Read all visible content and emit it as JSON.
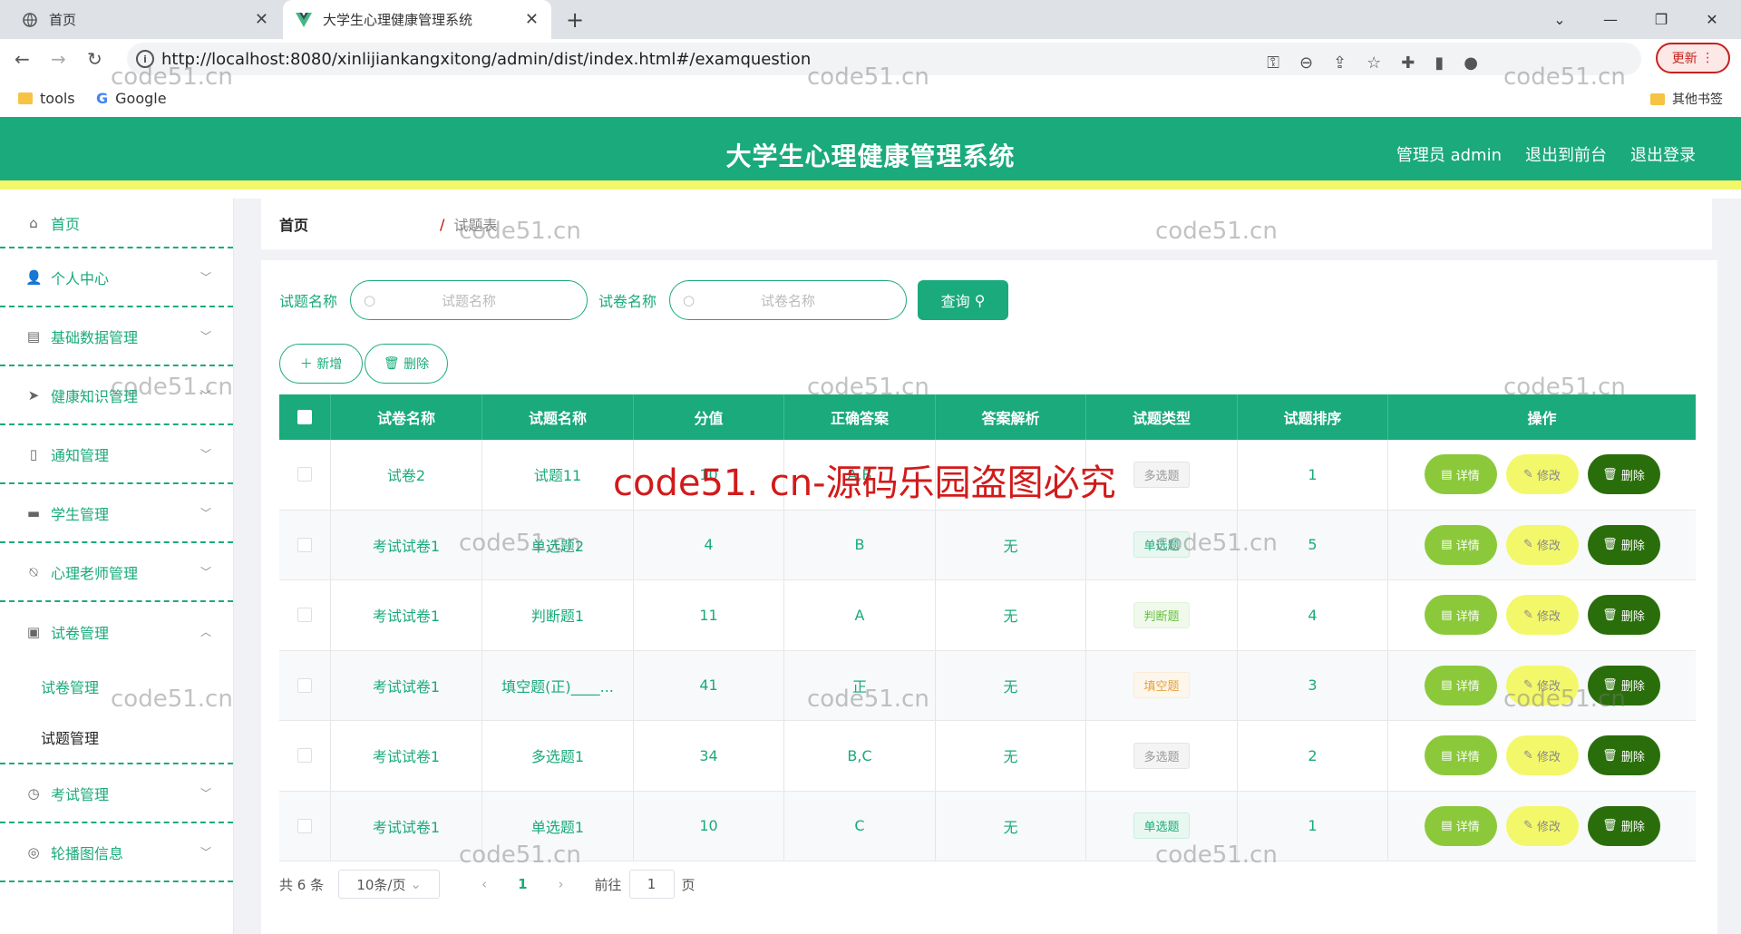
{
  "browser": {
    "tabs": [
      {
        "label": "首页"
      },
      {
        "label": "大学生心理健康管理系统"
      }
    ],
    "url": "http://localhost:8080/xinlijiankangxitong/admin/dist/index.html#/examquestion",
    "update_label": "更新",
    "bookmarks": [
      {
        "label": "tools"
      },
      {
        "label": "Google"
      }
    ],
    "other_bookmarks": "其他书签"
  },
  "header": {
    "title": "大学生心理健康管理系统",
    "admin_label": "管理员 admin",
    "front_label": "退出到前台",
    "logout_label": "退出登录"
  },
  "sidebar": {
    "items": [
      {
        "label": "首页",
        "icon": "home-icon"
      },
      {
        "label": "个人中心",
        "icon": "user-icon"
      },
      {
        "label": "基础数据管理",
        "icon": "clipboard-icon"
      },
      {
        "label": "健康知识管理",
        "icon": "send-icon"
      },
      {
        "label": "通知管理",
        "icon": "phone-icon"
      },
      {
        "label": "学生管理",
        "icon": "brush-icon"
      },
      {
        "label": "心理老师管理",
        "icon": "bell-off-icon"
      },
      {
        "label": "试卷管理",
        "icon": "checklist-icon"
      },
      {
        "label": "考试管理",
        "icon": "clock-icon"
      },
      {
        "label": "轮播图信息",
        "icon": "compass-icon"
      }
    ],
    "sub_items": [
      {
        "label": "试卷管理"
      },
      {
        "label": "试题管理"
      }
    ]
  },
  "breadcrumb": {
    "home": "首页",
    "separator": "/",
    "current": "试题表"
  },
  "search": {
    "question_label": "试题名称",
    "question_placeholder": "试题名称",
    "paper_label": "试卷名称",
    "paper_placeholder": "试卷名称",
    "query_label": "查询"
  },
  "actions": {
    "add_label": "新增",
    "delete_label": "删除"
  },
  "table": {
    "headers": [
      "试卷名称",
      "试题名称",
      "分值",
      "正确答案",
      "答案解析",
      "试题类型",
      "试题排序",
      "操作"
    ],
    "rows": [
      {
        "paper": "试卷2",
        "question": "试题11",
        "score": "10",
        "answer": "A,B",
        "analysis": "",
        "type": "多选题",
        "type_class": "multi",
        "order": "1"
      },
      {
        "paper": "考试试卷1",
        "question": "单选题2",
        "score": "4",
        "answer": "B",
        "analysis": "无",
        "type": "单选题",
        "type_class": "single",
        "order": "5"
      },
      {
        "paper": "考试试卷1",
        "question": "判断题1",
        "score": "11",
        "answer": "A",
        "analysis": "无",
        "type": "判断题",
        "type_class": "judge",
        "order": "4"
      },
      {
        "paper": "考试试卷1",
        "question": "填空题(正)____...",
        "score": "41",
        "answer": "正",
        "analysis": "无",
        "type": "填空题",
        "type_class": "fill",
        "order": "3"
      },
      {
        "paper": "考试试卷1",
        "question": "多选题1",
        "score": "34",
        "answer": "B,C",
        "analysis": "无",
        "type": "多选题",
        "type_class": "multi",
        "order": "2"
      },
      {
        "paper": "考试试卷1",
        "question": "单选题1",
        "score": "10",
        "answer": "C",
        "analysis": "无",
        "type": "单选题",
        "type_class": "single",
        "order": "1"
      }
    ],
    "op_detail": "详情",
    "op_edit": "修改",
    "op_delete": "删除"
  },
  "pager": {
    "total": "共 6 条",
    "page_size": "10条/页",
    "current_page": "1",
    "goto_label": "前往",
    "goto_value": "1",
    "page_suffix": "页"
  },
  "watermark": {
    "text": "code51.cn",
    "red_text": "code51. cn-源码乐园盗图必究"
  },
  "colors": {
    "primary": "#1aaa7b",
    "accent_yellow": "#f3f86b",
    "detail": "#8bc93b",
    "delete": "#2a6e0b"
  }
}
